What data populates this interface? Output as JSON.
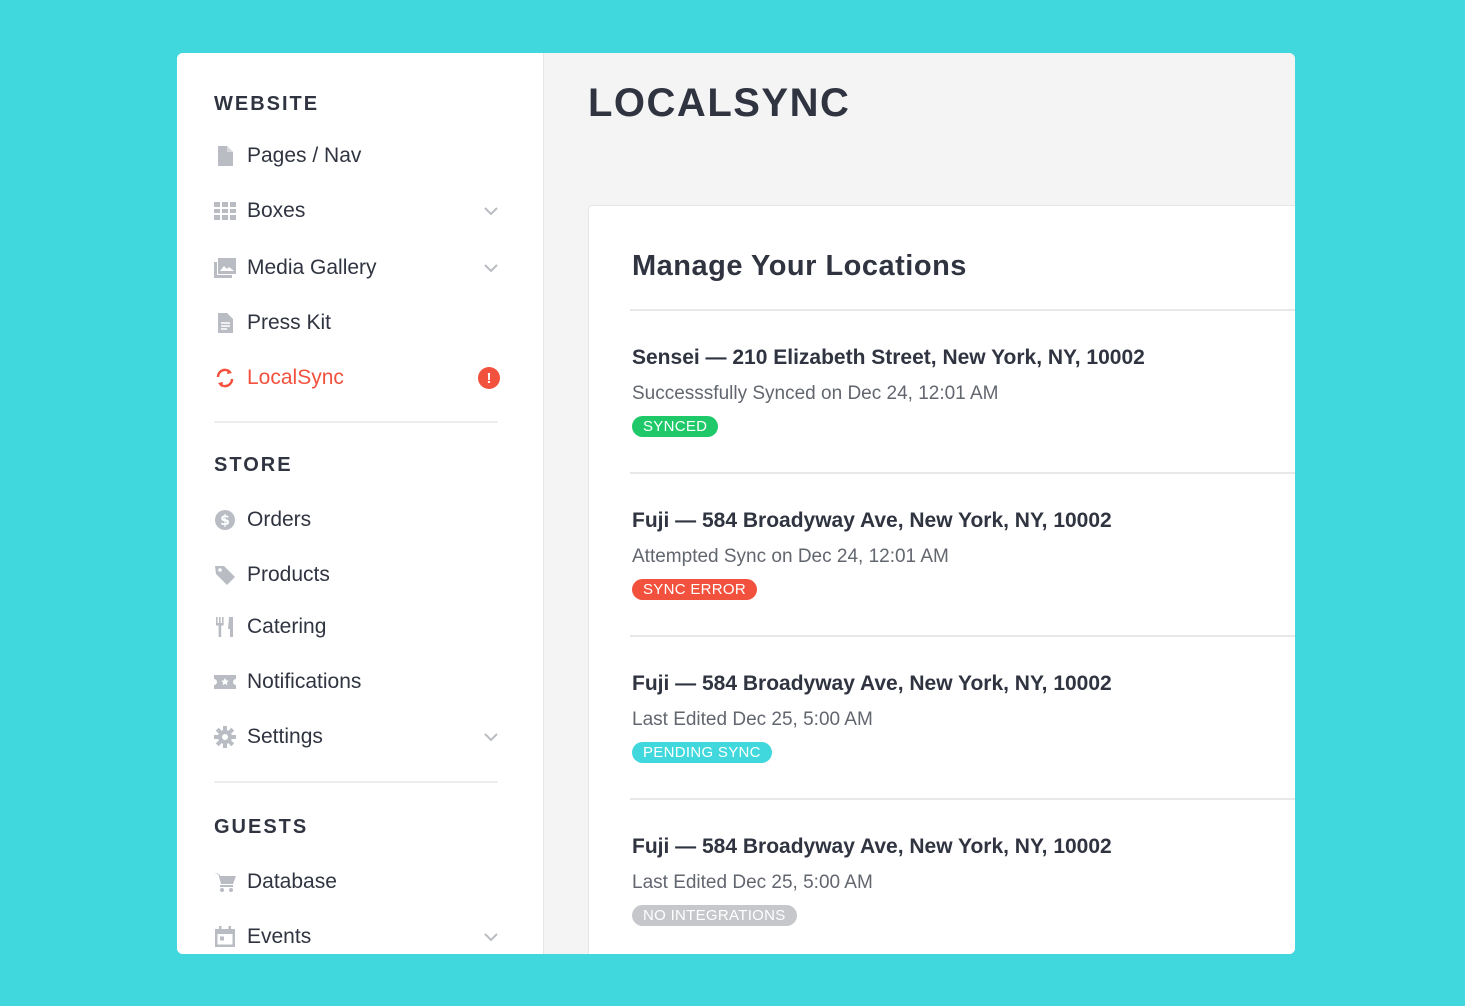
{
  "sidebar": {
    "sections": [
      {
        "title": "WEBSITE",
        "items": [
          {
            "label": "Pages / Nav",
            "icon": "page-icon"
          },
          {
            "label": "Boxes",
            "icon": "grid-icon",
            "expandable": true
          },
          {
            "label": "Media Gallery",
            "icon": "image-icon",
            "expandable": true
          },
          {
            "label": "Press Kit",
            "icon": "document-icon"
          },
          {
            "label": "LocalSync",
            "icon": "sync-icon",
            "active": true,
            "alert": "!"
          }
        ]
      },
      {
        "title": "STORE",
        "items": [
          {
            "label": "Orders",
            "icon": "dollar-icon"
          },
          {
            "label": "Products",
            "icon": "tag-icon"
          },
          {
            "label": "Catering",
            "icon": "fork-knife-icon"
          },
          {
            "label": "Notifications",
            "icon": "ticket-icon"
          },
          {
            "label": "Settings",
            "icon": "gear-icon",
            "expandable": true
          }
        ]
      },
      {
        "title": "GUESTS",
        "items": [
          {
            "label": "Database",
            "icon": "cart-icon"
          },
          {
            "label": "Events",
            "icon": "calendar-icon",
            "expandable": true
          }
        ]
      }
    ]
  },
  "main": {
    "title": "LOCALSYNC",
    "card_title": "Manage Your Locations",
    "locations": [
      {
        "name": "Sensei — 210 Elizabeth Street, New York, NY, 10002",
        "status": "Successsfully Synced on Dec 24, 12:01 AM",
        "badge": "SYNCED",
        "badge_color": "#1fc96a"
      },
      {
        "name": "Fuji — 584 Broadyway Ave, New York, NY, 10002",
        "status": "Attempted Sync on Dec 24, 12:01 AM",
        "badge": "SYNC ERROR",
        "badge_color": "#f2513d"
      },
      {
        "name": "Fuji — 584 Broadyway Ave, New York, NY, 10002",
        "status": "Last Edited Dec 25, 5:00 AM",
        "badge": "PENDING SYNC",
        "badge_color": "#40d8dc"
      },
      {
        "name": "Fuji — 584 Broadyway Ave, New York, NY, 10002",
        "status": "Last Edited Dec 25, 5:00 AM",
        "badge": "NO INTEGRATIONS",
        "badge_color": "#c6c7cb"
      }
    ]
  },
  "colors": {
    "background": "#40d8dc",
    "accent": "#f2513d",
    "text": "#2f3440",
    "icon": "#b9bcc3"
  }
}
